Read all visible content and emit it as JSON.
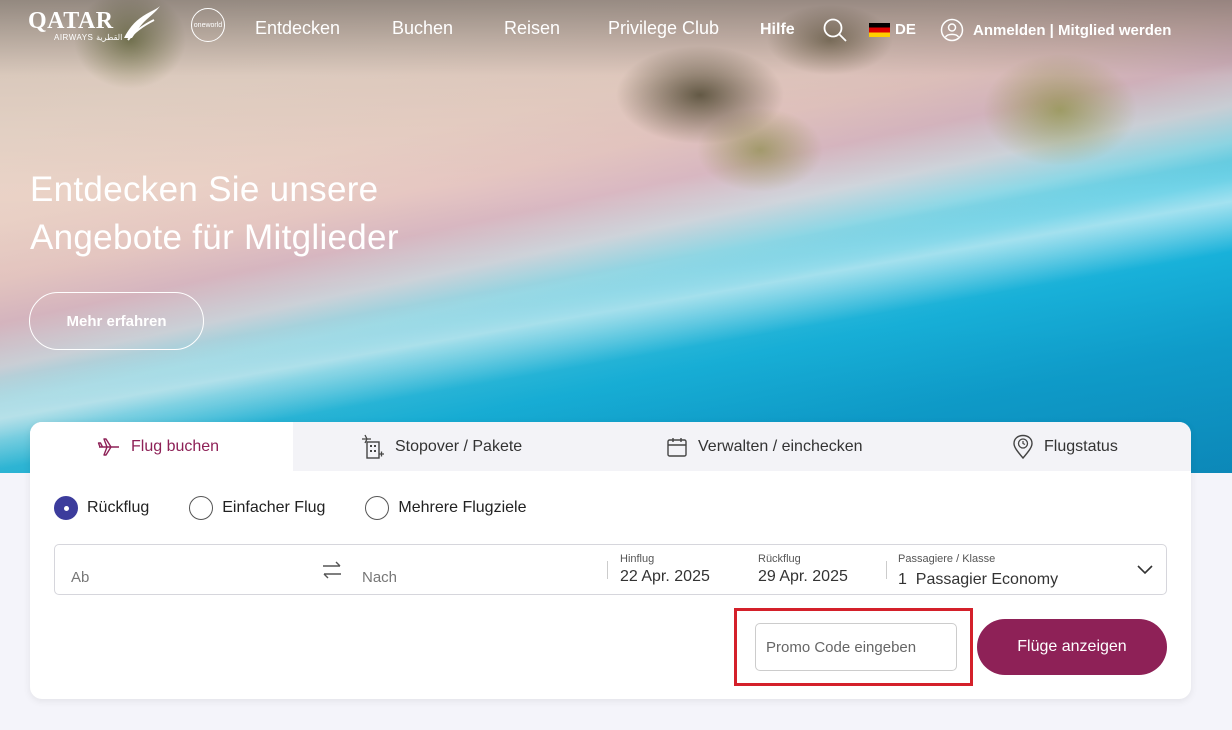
{
  "nav": {
    "logo_text": "QATAR",
    "logo_sub": "AIRWAYS القطرية",
    "oneworld_text": "oneworld",
    "links": [
      "Entdecken",
      "Buchen",
      "Reisen",
      "Privilege Club"
    ],
    "help": "Hilfe",
    "language": "DE",
    "account": "Anmelden | Mitglied werden"
  },
  "hero": {
    "title_line1": "Entdecken Sie unsere",
    "title_line2": "Angebote für Mitglieder",
    "cta": "Mehr erfahren"
  },
  "booking": {
    "tabs": [
      {
        "label": "Flug buchen",
        "icon": "plane-icon",
        "active": true
      },
      {
        "label": "Stopover / Pakete",
        "icon": "hotel-plane-icon",
        "active": false
      },
      {
        "label": "Verwalten / einchecken",
        "icon": "calendar-icon",
        "active": false
      },
      {
        "label": "Flugstatus",
        "icon": "location-clock-icon",
        "active": false
      }
    ],
    "trip_types": [
      {
        "label": "Rückflug",
        "checked": true
      },
      {
        "label": "Einfacher Flug",
        "checked": false
      },
      {
        "label": "Mehrere Flugziele",
        "checked": false
      }
    ],
    "from_placeholder": "Ab",
    "to_placeholder": "Nach",
    "depart_label": "Hinflug",
    "depart_value": "22 Apr. 2025",
    "return_label": "Rückflug",
    "return_value": "29 Apr. 2025",
    "pax_label": "Passagiere / Klasse",
    "pax_value": "1  Passagier Economy",
    "promo_placeholder": "Promo Code eingeben",
    "submit": "Flüge anzeigen"
  },
  "colors": {
    "brand": "#8e2157",
    "radio_checked": "#3c3c9c",
    "highlight_box": "#d4202a"
  }
}
